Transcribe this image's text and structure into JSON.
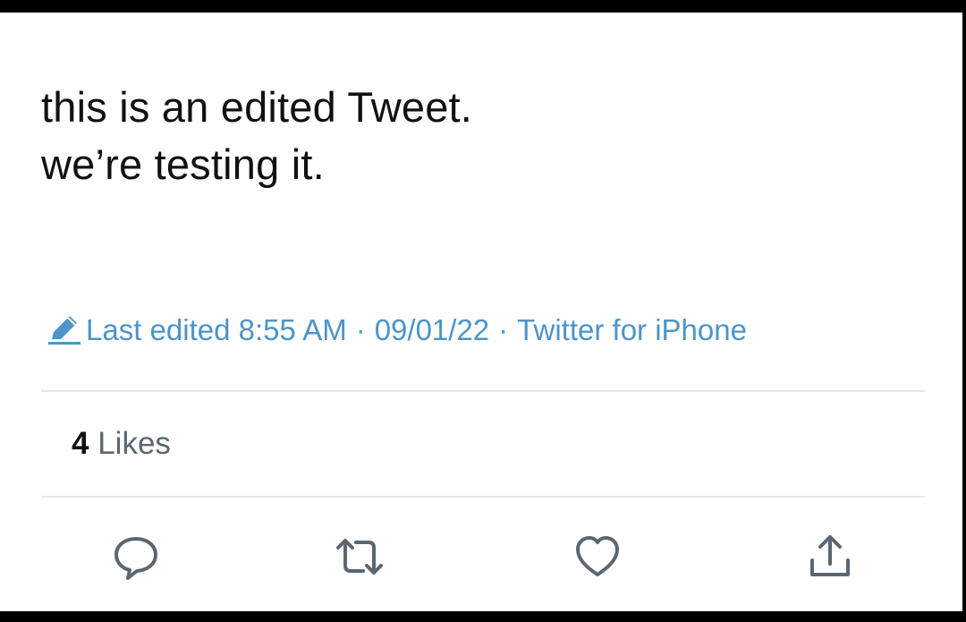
{
  "tweet": {
    "line1": "this is an edited Tweet.",
    "line2": "we’re testing it."
  },
  "meta": {
    "edit_icon": "pencil-icon",
    "last_edited": "Last edited 8:55 AM",
    "separator": "·",
    "date": "09/01/22",
    "source": "Twitter for iPhone",
    "color": "#4d94c9"
  },
  "stats": {
    "likes_count": "4",
    "likes_label": "Likes"
  },
  "actions": {
    "reply_icon": "comment-icon",
    "retweet_icon": "retweet-icon",
    "like_icon": "heart-icon",
    "share_icon": "share-icon"
  }
}
